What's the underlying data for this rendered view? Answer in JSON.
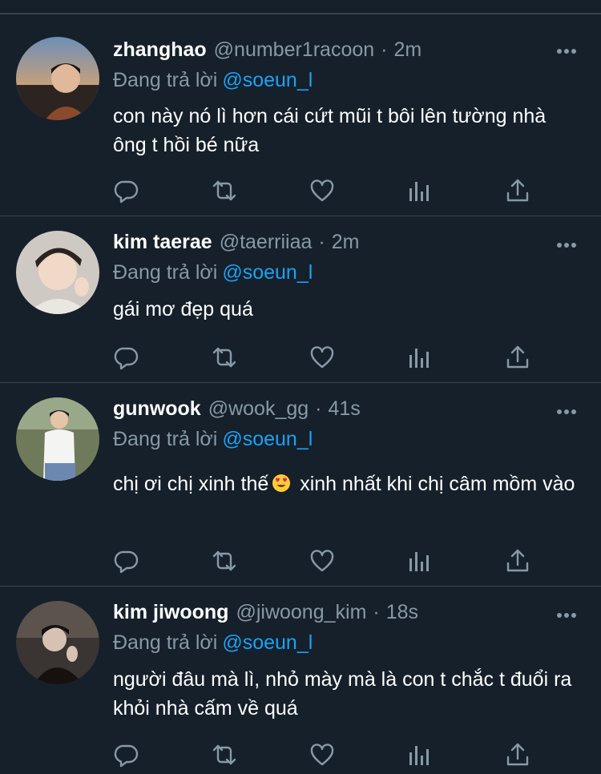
{
  "tweets": [
    {
      "name": "zhanghao",
      "handle": "@number1racoon",
      "dot": "·",
      "time": "2m",
      "replying_prefix": "Đang trả lời",
      "replying_to": "@soeun_l",
      "text_before_emoji": "con này nó lì hơn cái cứt mũi t bôi lên tường nhà ông t hồi bé nữa",
      "text_after_emoji": ""
    },
    {
      "name": "kim taerae",
      "handle": "@taerriiaa",
      "dot": "·",
      "time": "2m",
      "replying_prefix": "Đang trả lời",
      "replying_to": "@soeun_l",
      "text_before_emoji": "gái mơ đẹp quá",
      "text_after_emoji": ""
    },
    {
      "name": "gunwook",
      "handle": "@wook_gg",
      "dot": "·",
      "time": "41s",
      "replying_prefix": "Đang trả lời",
      "replying_to": "@soeun_l",
      "text_before_emoji": "chị ơi chị xinh thế",
      "text_after_emoji": " xinh nhất khi chị câm mồm vào"
    },
    {
      "name": "kim jiwoong",
      "handle": "@jiwoong_kim",
      "dot": "·",
      "time": "18s",
      "replying_prefix": "Đang trả lời",
      "replying_to": "@soeun_l",
      "text_before_emoji": "người đâu mà lì, nhỏ mày mà là con t chắc t đuổi ra khỏi nhà cấm về quá",
      "text_after_emoji": ""
    }
  ],
  "icons": {
    "reply": "reply-icon",
    "retweet": "retweet-icon",
    "like": "heart-icon",
    "analytics": "analytics-icon",
    "share": "share-icon",
    "more": "more-icon"
  },
  "colors": {
    "background": "#15202b",
    "divider": "#38444d",
    "secondary_text": "#8899a6",
    "mention": "#1da1f2",
    "primary_text": "#ffffff"
  }
}
